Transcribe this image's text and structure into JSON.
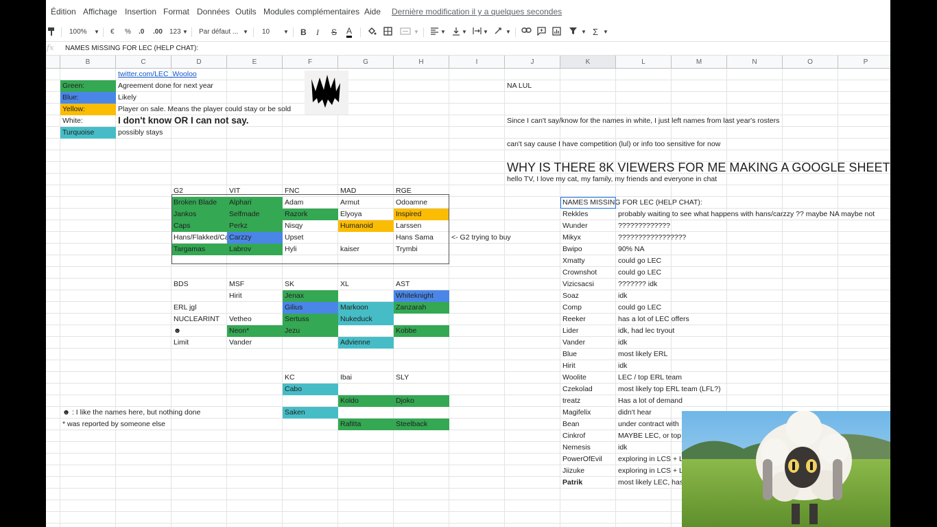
{
  "menu": [
    "Édition",
    "Affichage",
    "Insertion",
    "Format",
    "Données",
    "Outils",
    "Modules complémentaires",
    "Aide"
  ],
  "last_modified": "Dernière modification il y a quelques secondes",
  "toolbar": {
    "zoom": "100%",
    "currency": "€",
    "percent": "%",
    "dec_less": ".0",
    "dec_more": ".00",
    "number_format": "123",
    "font": "Par défaut ...",
    "font_size": "10",
    "bold": "B",
    "italic": "I",
    "strike": "S",
    "text_color": "A"
  },
  "formula_bar": {
    "label": "fx",
    "content": "NAMES MISSING FOR LEC (HELP CHAT):"
  },
  "columns": [
    "B",
    "C",
    "D",
    "E",
    "F",
    "G",
    "H",
    "I",
    "J",
    "K",
    "L",
    "M",
    "N",
    "O",
    "P"
  ],
  "selected_column": "K",
  "cells": [
    {
      "col": "C",
      "row": 0,
      "text": "twitter.com/LEC_Wooloo",
      "style": "link"
    },
    {
      "col": "B",
      "row": 1,
      "text": "Green:",
      "fill": "green"
    },
    {
      "col": "C",
      "row": 1,
      "text": "Agreement done for next year"
    },
    {
      "col": "J",
      "row": 1,
      "text": "NA LUL"
    },
    {
      "col": "B",
      "row": 2,
      "text": "Blue:",
      "fill": "blue"
    },
    {
      "col": "C",
      "row": 2,
      "text": "Likely"
    },
    {
      "col": "B",
      "row": 3,
      "text": "Yellow:",
      "fill": "yellow"
    },
    {
      "col": "C",
      "row": 3,
      "text": "Player on sale. Means the player could stay or be sold"
    },
    {
      "col": "B",
      "row": 4,
      "text": "White:"
    },
    {
      "col": "C",
      "row": 4,
      "text": "I don't know OR I can not say.",
      "style": "big"
    },
    {
      "col": "J",
      "row": 4,
      "text": "Since I can't say/know for the names in white, I just left names from last year's rosters"
    },
    {
      "col": "B",
      "row": 5,
      "text": "Turquoise",
      "fill": "teal"
    },
    {
      "col": "C",
      "row": 5,
      "text": "possibly stays"
    },
    {
      "col": "J",
      "row": 6,
      "text": "can't say cause I have competition (lul) or info too sensitive for now"
    },
    {
      "col": "J",
      "row": 8,
      "text": "WHY IS THERE 8K VIEWERS FOR ME MAKING A GOOGLE SHEET",
      "style": "huge"
    },
    {
      "col": "J",
      "row": 9,
      "text": "hello TV, I love my cat, my family, my friends and everyone in chat"
    },
    {
      "col": "D",
      "row": 10,
      "text": "G2"
    },
    {
      "col": "E",
      "row": 10,
      "text": "VIT"
    },
    {
      "col": "F",
      "row": 10,
      "text": "FNC"
    },
    {
      "col": "G",
      "row": 10,
      "text": "MAD"
    },
    {
      "col": "H",
      "row": 10,
      "text": "RGE"
    },
    {
      "col": "D",
      "row": 11,
      "text": "Broken Blade",
      "fill": "green"
    },
    {
      "col": "E",
      "row": 11,
      "text": "Alphari",
      "fill": "green"
    },
    {
      "col": "F",
      "row": 11,
      "text": "Adam"
    },
    {
      "col": "G",
      "row": 11,
      "text": "Armut"
    },
    {
      "col": "H",
      "row": 11,
      "text": "Odoamne"
    },
    {
      "col": "K",
      "row": 11,
      "text": "NAMES MISSING FOR LEC (HELP CHAT):",
      "style": "selbox"
    },
    {
      "col": "D",
      "row": 12,
      "text": "Jankos",
      "fill": "green"
    },
    {
      "col": "E",
      "row": 12,
      "text": "Selfmade",
      "fill": "green"
    },
    {
      "col": "F",
      "row": 12,
      "text": "Razork",
      "fill": "green"
    },
    {
      "col": "G",
      "row": 12,
      "text": "Elyoya"
    },
    {
      "col": "H",
      "row": 12,
      "text": "Inspired",
      "fill": "yellow"
    },
    {
      "col": "K",
      "row": 12,
      "text": "Rekkles"
    },
    {
      "col": "L",
      "row": 12,
      "text": "probably waiting to see what happens with hans/carzzy ?? maybe NA maybe not"
    },
    {
      "col": "D",
      "row": 13,
      "text": "Caps",
      "fill": "green"
    },
    {
      "col": "E",
      "row": 13,
      "text": "Perkz",
      "fill": "green"
    },
    {
      "col": "F",
      "row": 13,
      "text": "Nisqy"
    },
    {
      "col": "G",
      "row": 13,
      "text": "Humanoid",
      "fill": "yellow"
    },
    {
      "col": "H",
      "row": 13,
      "text": "Larssen"
    },
    {
      "col": "K",
      "row": 13,
      "text": "Wunder"
    },
    {
      "col": "L",
      "row": 13,
      "text": "?????????????"
    },
    {
      "col": "D",
      "row": 14,
      "text": "Hans/Flakked/Carzzy",
      "style": "clip"
    },
    {
      "col": "E",
      "row": 14,
      "text": "Carzzy",
      "fill": "blue"
    },
    {
      "col": "F",
      "row": 14,
      "text": "Upset"
    },
    {
      "col": "H",
      "row": 14,
      "text": "Hans Sama"
    },
    {
      "col": "I",
      "row": 14,
      "text": "<- G2 trying to buy"
    },
    {
      "col": "K",
      "row": 14,
      "text": "Mikyx"
    },
    {
      "col": "L",
      "row": 14,
      "text": "?????????????????"
    },
    {
      "col": "D",
      "row": 15,
      "text": "Targamas",
      "fill": "green"
    },
    {
      "col": "E",
      "row": 15,
      "text": "Labrov",
      "fill": "green"
    },
    {
      "col": "F",
      "row": 15,
      "text": "Hyli"
    },
    {
      "col": "G",
      "row": 15,
      "text": "kaiser"
    },
    {
      "col": "H",
      "row": 15,
      "text": "Trymbi"
    },
    {
      "col": "K",
      "row": 15,
      "text": "Bwipo"
    },
    {
      "col": "L",
      "row": 15,
      "text": "90% NA"
    },
    {
      "col": "K",
      "row": 16,
      "text": "Xmatty"
    },
    {
      "col": "L",
      "row": 16,
      "text": "could go LEC"
    },
    {
      "col": "K",
      "row": 17,
      "text": "Crownshot"
    },
    {
      "col": "L",
      "row": 17,
      "text": "could go LEC"
    },
    {
      "col": "D",
      "row": 18,
      "text": "BDS"
    },
    {
      "col": "E",
      "row": 18,
      "text": "MSF"
    },
    {
      "col": "F",
      "row": 18,
      "text": "SK"
    },
    {
      "col": "G",
      "row": 18,
      "text": "XL"
    },
    {
      "col": "H",
      "row": 18,
      "text": "AST"
    },
    {
      "col": "K",
      "row": 18,
      "text": "Vizicsacsi"
    },
    {
      "col": "L",
      "row": 18,
      "text": "??????? idk"
    },
    {
      "col": "E",
      "row": 19,
      "text": "Hirit"
    },
    {
      "col": "F",
      "row": 19,
      "text": "Jenax",
      "fill": "green"
    },
    {
      "col": "H",
      "row": 19,
      "text": "Whiteknight",
      "fill": "blue"
    },
    {
      "col": "K",
      "row": 19,
      "text": "Soaz"
    },
    {
      "col": "L",
      "row": 19,
      "text": "idk"
    },
    {
      "col": "D",
      "row": 20,
      "text": "ERL jgl"
    },
    {
      "col": "F",
      "row": 20,
      "text": "Gilius",
      "fill": "blue"
    },
    {
      "col": "G",
      "row": 20,
      "text": "Markoon",
      "fill": "teal"
    },
    {
      "col": "H",
      "row": 20,
      "text": "Zanzarah",
      "fill": "green"
    },
    {
      "col": "K",
      "row": 20,
      "text": "Comp"
    },
    {
      "col": "L",
      "row": 20,
      "text": "could go LEC"
    },
    {
      "col": "D",
      "row": 21,
      "text": "NUCLEARINT"
    },
    {
      "col": "E",
      "row": 21,
      "text": "Vetheo"
    },
    {
      "col": "F",
      "row": 21,
      "text": "Sertuss",
      "fill": "green"
    },
    {
      "col": "G",
      "row": 21,
      "text": "Nukeduck",
      "fill": "teal"
    },
    {
      "col": "K",
      "row": 21,
      "text": "Reeker"
    },
    {
      "col": "L",
      "row": 21,
      "text": "has a lot of LEC offers"
    },
    {
      "col": "D",
      "row": 22,
      "text": "☻"
    },
    {
      "col": "E",
      "row": 22,
      "text": "Neon*",
      "fill": "green"
    },
    {
      "col": "F",
      "row": 22,
      "text": "Jezu",
      "fill": "green"
    },
    {
      "col": "H",
      "row": 22,
      "text": "Kobbe",
      "fill": "green"
    },
    {
      "col": "K",
      "row": 22,
      "text": "Lider"
    },
    {
      "col": "L",
      "row": 22,
      "text": "idk, had lec tryout"
    },
    {
      "col": "D",
      "row": 23,
      "text": "Limit"
    },
    {
      "col": "E",
      "row": 23,
      "text": "Vander"
    },
    {
      "col": "G",
      "row": 23,
      "text": "Advienne",
      "fill": "teal"
    },
    {
      "col": "K",
      "row": 23,
      "text": "Vander"
    },
    {
      "col": "L",
      "row": 23,
      "text": "idk"
    },
    {
      "col": "K",
      "row": 24,
      "text": "Blue"
    },
    {
      "col": "L",
      "row": 24,
      "text": "most likely ERL"
    },
    {
      "col": "K",
      "row": 25,
      "text": "Hirit"
    },
    {
      "col": "L",
      "row": 25,
      "text": "idk"
    },
    {
      "col": "F",
      "row": 26,
      "text": "KC"
    },
    {
      "col": "G",
      "row": 26,
      "text": "Ibai"
    },
    {
      "col": "H",
      "row": 26,
      "text": "SLY"
    },
    {
      "col": "K",
      "row": 26,
      "text": "Woolite"
    },
    {
      "col": "L",
      "row": 26,
      "text": "LEC / top ERL team"
    },
    {
      "col": "F",
      "row": 27,
      "text": "Cabo",
      "fill": "teal"
    },
    {
      "col": "K",
      "row": 27,
      "text": "Czekolad"
    },
    {
      "col": "L",
      "row": 27,
      "text": "most likely top ERL team (LFL?)"
    },
    {
      "col": "G",
      "row": 28,
      "text": "Koldo",
      "fill": "green"
    },
    {
      "col": "H",
      "row": 28,
      "text": "Djoko",
      "fill": "green"
    },
    {
      "col": "K",
      "row": 28,
      "text": "treatz"
    },
    {
      "col": "L",
      "row": 28,
      "text": "Has a lot of demand"
    },
    {
      "col": "B",
      "row": 29,
      "text": "☻ : I like the names here, but nothing done"
    },
    {
      "col": "F",
      "row": 29,
      "text": "Saken",
      "fill": "teal"
    },
    {
      "col": "K",
      "row": 29,
      "text": "Magifelix"
    },
    {
      "col": "L",
      "row": 29,
      "text": "didn't hear"
    },
    {
      "col": "B",
      "row": 30,
      "text": "* was reported by someone else"
    },
    {
      "col": "G",
      "row": 30,
      "text": "Rafitta",
      "fill": "green"
    },
    {
      "col": "H",
      "row": 30,
      "text": "Steelback",
      "fill": "green"
    },
    {
      "col": "K",
      "row": 30,
      "text": "Bean"
    },
    {
      "col": "L",
      "row": 30,
      "text": "under contract with"
    },
    {
      "col": "K",
      "row": 31,
      "text": "Cinkrof"
    },
    {
      "col": "L",
      "row": 31,
      "text": "MAYBE LEC, or top"
    },
    {
      "col": "K",
      "row": 32,
      "text": "Nemesis"
    },
    {
      "col": "L",
      "row": 32,
      "text": "idk"
    },
    {
      "col": "K",
      "row": 33,
      "text": "PowerOfEvil"
    },
    {
      "col": "L",
      "row": 33,
      "text": "exploring in LCS + L"
    },
    {
      "col": "K",
      "row": 34,
      "text": "Jiizuke"
    },
    {
      "col": "L",
      "row": 34,
      "text": "exploring in LCS + L"
    },
    {
      "col": "K",
      "row": 35,
      "text": "Patrik",
      "style": "bold"
    },
    {
      "col": "L",
      "row": 35,
      "text": "most likely LEC, has"
    }
  ],
  "colors": {
    "green": "#34a853",
    "blue": "#4a86e8",
    "yellow": "#fbbc04",
    "teal": "#46bdc6",
    "selection": "#1a73e8"
  },
  "icons": [
    "paint-format-icon",
    "zoom-dropdown-icon",
    "borders-icon",
    "merge-icon",
    "align-icon",
    "valign-icon",
    "wrap-icon",
    "rotate-icon",
    "link-icon",
    "comment-icon",
    "chart-icon",
    "filter-icon",
    "function-icon",
    "fill-color-icon"
  ]
}
